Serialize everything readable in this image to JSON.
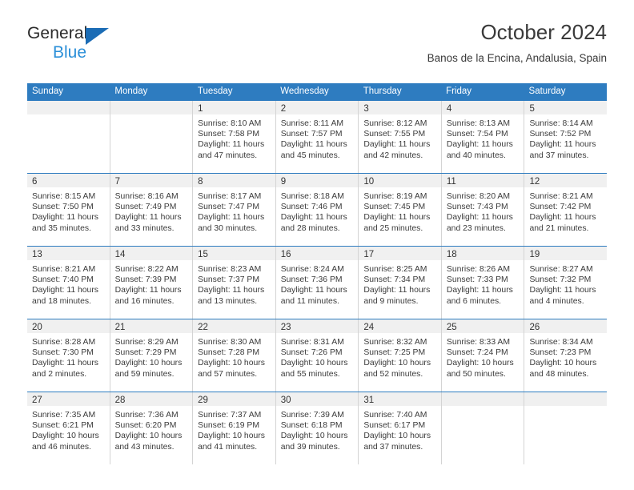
{
  "brand": {
    "name_part1": "General",
    "name_part2": "Blue",
    "logo_icon": "triangle-logo-icon"
  },
  "header": {
    "month_title": "October 2024",
    "location": "Banos de la Encina, Andalusia, Spain"
  },
  "calendar": {
    "weekdays": [
      "Sunday",
      "Monday",
      "Tuesday",
      "Wednesday",
      "Thursday",
      "Friday",
      "Saturday"
    ],
    "accent_color": "#2e7cc0",
    "daynum_band_color": "#f0f0f0",
    "weeks": [
      [
        {
          "day": "",
          "sunrise": "",
          "sunset": "",
          "daylight1": "",
          "daylight2": ""
        },
        {
          "day": "",
          "sunrise": "",
          "sunset": "",
          "daylight1": "",
          "daylight2": ""
        },
        {
          "day": "1",
          "sunrise": "Sunrise: 8:10 AM",
          "sunset": "Sunset: 7:58 PM",
          "daylight1": "Daylight: 11 hours",
          "daylight2": "and 47 minutes."
        },
        {
          "day": "2",
          "sunrise": "Sunrise: 8:11 AM",
          "sunset": "Sunset: 7:57 PM",
          "daylight1": "Daylight: 11 hours",
          "daylight2": "and 45 minutes."
        },
        {
          "day": "3",
          "sunrise": "Sunrise: 8:12 AM",
          "sunset": "Sunset: 7:55 PM",
          "daylight1": "Daylight: 11 hours",
          "daylight2": "and 42 minutes."
        },
        {
          "day": "4",
          "sunrise": "Sunrise: 8:13 AM",
          "sunset": "Sunset: 7:54 PM",
          "daylight1": "Daylight: 11 hours",
          "daylight2": "and 40 minutes."
        },
        {
          "day": "5",
          "sunrise": "Sunrise: 8:14 AM",
          "sunset": "Sunset: 7:52 PM",
          "daylight1": "Daylight: 11 hours",
          "daylight2": "and 37 minutes."
        }
      ],
      [
        {
          "day": "6",
          "sunrise": "Sunrise: 8:15 AM",
          "sunset": "Sunset: 7:50 PM",
          "daylight1": "Daylight: 11 hours",
          "daylight2": "and 35 minutes."
        },
        {
          "day": "7",
          "sunrise": "Sunrise: 8:16 AM",
          "sunset": "Sunset: 7:49 PM",
          "daylight1": "Daylight: 11 hours",
          "daylight2": "and 33 minutes."
        },
        {
          "day": "8",
          "sunrise": "Sunrise: 8:17 AM",
          "sunset": "Sunset: 7:47 PM",
          "daylight1": "Daylight: 11 hours",
          "daylight2": "and 30 minutes."
        },
        {
          "day": "9",
          "sunrise": "Sunrise: 8:18 AM",
          "sunset": "Sunset: 7:46 PM",
          "daylight1": "Daylight: 11 hours",
          "daylight2": "and 28 minutes."
        },
        {
          "day": "10",
          "sunrise": "Sunrise: 8:19 AM",
          "sunset": "Sunset: 7:45 PM",
          "daylight1": "Daylight: 11 hours",
          "daylight2": "and 25 minutes."
        },
        {
          "day": "11",
          "sunrise": "Sunrise: 8:20 AM",
          "sunset": "Sunset: 7:43 PM",
          "daylight1": "Daylight: 11 hours",
          "daylight2": "and 23 minutes."
        },
        {
          "day": "12",
          "sunrise": "Sunrise: 8:21 AM",
          "sunset": "Sunset: 7:42 PM",
          "daylight1": "Daylight: 11 hours",
          "daylight2": "and 21 minutes."
        }
      ],
      [
        {
          "day": "13",
          "sunrise": "Sunrise: 8:21 AM",
          "sunset": "Sunset: 7:40 PM",
          "daylight1": "Daylight: 11 hours",
          "daylight2": "and 18 minutes."
        },
        {
          "day": "14",
          "sunrise": "Sunrise: 8:22 AM",
          "sunset": "Sunset: 7:39 PM",
          "daylight1": "Daylight: 11 hours",
          "daylight2": "and 16 minutes."
        },
        {
          "day": "15",
          "sunrise": "Sunrise: 8:23 AM",
          "sunset": "Sunset: 7:37 PM",
          "daylight1": "Daylight: 11 hours",
          "daylight2": "and 13 minutes."
        },
        {
          "day": "16",
          "sunrise": "Sunrise: 8:24 AM",
          "sunset": "Sunset: 7:36 PM",
          "daylight1": "Daylight: 11 hours",
          "daylight2": "and 11 minutes."
        },
        {
          "day": "17",
          "sunrise": "Sunrise: 8:25 AM",
          "sunset": "Sunset: 7:34 PM",
          "daylight1": "Daylight: 11 hours",
          "daylight2": "and 9 minutes."
        },
        {
          "day": "18",
          "sunrise": "Sunrise: 8:26 AM",
          "sunset": "Sunset: 7:33 PM",
          "daylight1": "Daylight: 11 hours",
          "daylight2": "and 6 minutes."
        },
        {
          "day": "19",
          "sunrise": "Sunrise: 8:27 AM",
          "sunset": "Sunset: 7:32 PM",
          "daylight1": "Daylight: 11 hours",
          "daylight2": "and 4 minutes."
        }
      ],
      [
        {
          "day": "20",
          "sunrise": "Sunrise: 8:28 AM",
          "sunset": "Sunset: 7:30 PM",
          "daylight1": "Daylight: 11 hours",
          "daylight2": "and 2 minutes."
        },
        {
          "day": "21",
          "sunrise": "Sunrise: 8:29 AM",
          "sunset": "Sunset: 7:29 PM",
          "daylight1": "Daylight: 10 hours",
          "daylight2": "and 59 minutes."
        },
        {
          "day": "22",
          "sunrise": "Sunrise: 8:30 AM",
          "sunset": "Sunset: 7:28 PM",
          "daylight1": "Daylight: 10 hours",
          "daylight2": "and 57 minutes."
        },
        {
          "day": "23",
          "sunrise": "Sunrise: 8:31 AM",
          "sunset": "Sunset: 7:26 PM",
          "daylight1": "Daylight: 10 hours",
          "daylight2": "and 55 minutes."
        },
        {
          "day": "24",
          "sunrise": "Sunrise: 8:32 AM",
          "sunset": "Sunset: 7:25 PM",
          "daylight1": "Daylight: 10 hours",
          "daylight2": "and 52 minutes."
        },
        {
          "day": "25",
          "sunrise": "Sunrise: 8:33 AM",
          "sunset": "Sunset: 7:24 PM",
          "daylight1": "Daylight: 10 hours",
          "daylight2": "and 50 minutes."
        },
        {
          "day": "26",
          "sunrise": "Sunrise: 8:34 AM",
          "sunset": "Sunset: 7:23 PM",
          "daylight1": "Daylight: 10 hours",
          "daylight2": "and 48 minutes."
        }
      ],
      [
        {
          "day": "27",
          "sunrise": "Sunrise: 7:35 AM",
          "sunset": "Sunset: 6:21 PM",
          "daylight1": "Daylight: 10 hours",
          "daylight2": "and 46 minutes."
        },
        {
          "day": "28",
          "sunrise": "Sunrise: 7:36 AM",
          "sunset": "Sunset: 6:20 PM",
          "daylight1": "Daylight: 10 hours",
          "daylight2": "and 43 minutes."
        },
        {
          "day": "29",
          "sunrise": "Sunrise: 7:37 AM",
          "sunset": "Sunset: 6:19 PM",
          "daylight1": "Daylight: 10 hours",
          "daylight2": "and 41 minutes."
        },
        {
          "day": "30",
          "sunrise": "Sunrise: 7:39 AM",
          "sunset": "Sunset: 6:18 PM",
          "daylight1": "Daylight: 10 hours",
          "daylight2": "and 39 minutes."
        },
        {
          "day": "31",
          "sunrise": "Sunrise: 7:40 AM",
          "sunset": "Sunset: 6:17 PM",
          "daylight1": "Daylight: 10 hours",
          "daylight2": "and 37 minutes."
        },
        {
          "day": "",
          "sunrise": "",
          "sunset": "",
          "daylight1": "",
          "daylight2": ""
        },
        {
          "day": "",
          "sunrise": "",
          "sunset": "",
          "daylight1": "",
          "daylight2": ""
        }
      ]
    ]
  }
}
